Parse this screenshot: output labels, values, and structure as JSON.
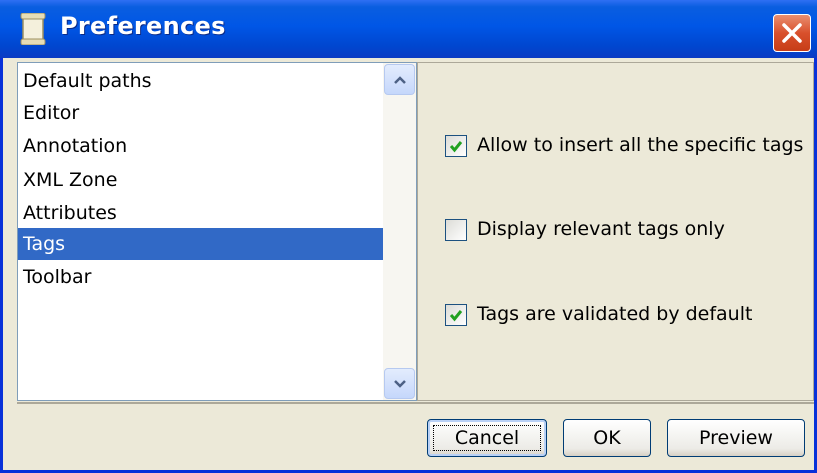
{
  "window": {
    "title": "Preferences",
    "icon": "document-icon",
    "close_icon": "close-icon"
  },
  "categories": {
    "items": [
      {
        "label": "Default paths"
      },
      {
        "label": "Editor"
      },
      {
        "label": "Annotation"
      },
      {
        "label": "XML Zone"
      },
      {
        "label": "Attributes"
      },
      {
        "label": "Tags",
        "selected": true
      },
      {
        "label": "Toolbar"
      }
    ],
    "selected_label": "Tags"
  },
  "options": [
    {
      "label": "Allow to insert all the specific tags",
      "checked": true
    },
    {
      "label": "Display relevant tags only",
      "checked": false
    },
    {
      "label": "Tags are validated by default",
      "checked": true
    }
  ],
  "buttons": {
    "cancel": "Cancel",
    "ok": "OK",
    "preview": "Preview"
  },
  "colors": {
    "titlebar": "#0055e5",
    "selection": "#3169c6",
    "dialog_background": "#ece9d8",
    "checkmark": "#21a121",
    "close_button": "#d9502c"
  }
}
